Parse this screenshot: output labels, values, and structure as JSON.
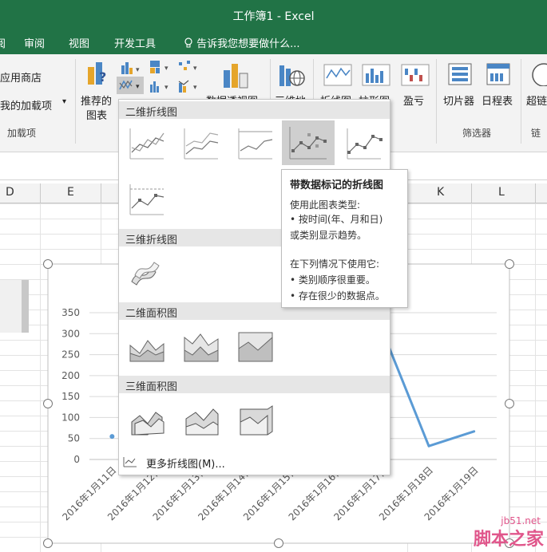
{
  "window": {
    "title": "工作簿1 - Excel"
  },
  "tabs": [
    "审阅",
    "视图",
    "开发工具"
  ],
  "tell_me": "告诉我您想要做什么...",
  "ribbon": {
    "app_store": "应用商店",
    "my_addins": "我的加载项",
    "addins_group": "加载项",
    "recommended_l1": "推荐的",
    "recommended_l2": "图表",
    "pivotchart": "数据透视图",
    "map3d": "三维地",
    "spark_line": "折线图",
    "spark_col": "柱形图",
    "spark_winloss": "盈亏",
    "slicer": "切片器",
    "timeline": "日程表",
    "filter_group": "筛选器",
    "hyperlink": "超链",
    "link_group": "链"
  },
  "columns": [
    "D",
    "E",
    "K",
    "L"
  ],
  "gallery": {
    "section_2d_line": "二维折线图",
    "section_3d_line": "三维折线图",
    "section_2d_area": "二维面积图",
    "section_3d_area": "三维面积图",
    "more_charts": "更多折线图(M)..."
  },
  "tooltip": {
    "title": "带数据标记的折线图",
    "line1": "使用此图表类型:",
    "line2": "• 按时间(年、月和日)",
    "line3": "或类别显示趋势。",
    "line4": "在下列情况下使用它:",
    "line5": "• 类别顺序很重要。",
    "line6": "• 存在很少的数据点。"
  },
  "chart_data": {
    "type": "line",
    "categories": [
      "2016年1月11日",
      "2016年1月12日",
      "2016年1月13日",
      "2016年1月14日",
      "2016年1月15日",
      "2016年1月16日",
      "2016年1月17日",
      "2016年1月18日",
      "2016年1月19日"
    ],
    "series": [
      {
        "values": [
          55,
          null,
          null,
          null,
          null,
          null,
          300,
          32,
          67
        ],
        "color": "#5b9bd5"
      }
    ],
    "yticks": [
      "350",
      "300",
      "250",
      "200",
      "150",
      "100",
      "50",
      "0"
    ],
    "ylim": [
      0,
      350
    ]
  },
  "watermark": {
    "main": "脚本之家",
    "site": "jb51.net"
  }
}
